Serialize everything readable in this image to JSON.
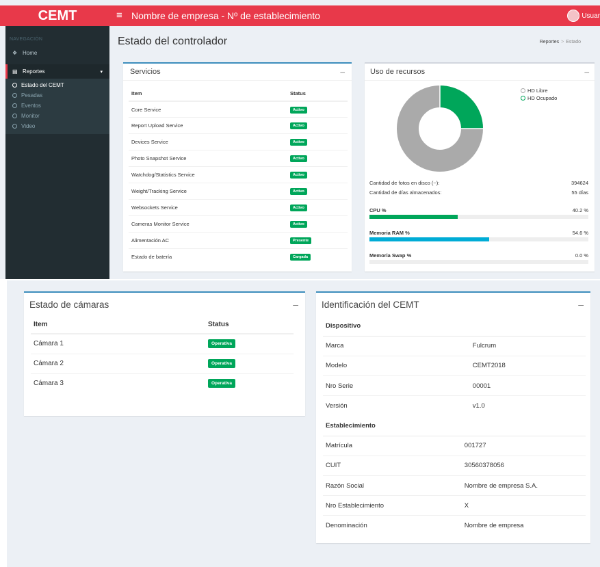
{
  "app": {
    "logo": "CEMT",
    "title": "Nombre de empresa - Nº de establecimiento",
    "user_label": "Usuar"
  },
  "sidebar": {
    "header": "NAVEGACIÓN",
    "items": [
      {
        "label": "Home",
        "icon": "home-icon"
      },
      {
        "label": "Reportes",
        "icon": "bar-chart-icon"
      }
    ],
    "subitems": [
      {
        "label": "Estado del CEMT"
      },
      {
        "label": "Pesadas"
      },
      {
        "label": "Eventos"
      },
      {
        "label": "Monitor"
      },
      {
        "label": "Video"
      }
    ]
  },
  "page": {
    "title": "Estado del controlador",
    "breadcrumb": [
      "Reportes",
      "Estado"
    ]
  },
  "services": {
    "title": "Servicios",
    "collapse_symbol": "–",
    "headers": [
      "Item",
      "Status"
    ],
    "rows": [
      {
        "item": "Core Service",
        "status": "Activo"
      },
      {
        "item": "Report Upload Service",
        "status": "Activo"
      },
      {
        "item": "Devices Service",
        "status": "Activo"
      },
      {
        "item": "Photo Snapshot Service",
        "status": "Activo"
      },
      {
        "item": "Watchdog/Statistics Service",
        "status": "Activo"
      },
      {
        "item": "Weight/Tracking Service",
        "status": "Activo"
      },
      {
        "item": "Websockets Service",
        "status": "Activo"
      },
      {
        "item": "Cameras Monitor Service",
        "status": "Activo"
      },
      {
        "item": "Alimentación AC",
        "status": "Presente"
      },
      {
        "item": "Estado de batería",
        "status": "Cargada"
      }
    ]
  },
  "resources": {
    "title": "Uso de recursos",
    "collapse_symbol": "–",
    "legend": [
      {
        "label": "HD Libre",
        "color": "#aaaaaa"
      },
      {
        "label": "HD Ocupado",
        "color": "#00a65a"
      }
    ],
    "disk_used_fraction": 0.25,
    "photos_label": "Cantidad de fotos en disco (~):",
    "photos_value": "394624",
    "days_label": "Cantidad de días almacenados:",
    "days_value": "55 días",
    "meters": [
      {
        "label": "CPU %",
        "value_text": "40.2 %",
        "percent": 40.2,
        "color": "#00a65a"
      },
      {
        "label": "Memoria RAM %",
        "value_text": "54.6 %",
        "percent": 54.6,
        "color": "#00acd6"
      },
      {
        "label": "Memoria Swap %",
        "value_text": "0.0 %",
        "percent": 0.0,
        "color": "#00a65a"
      }
    ]
  },
  "cameras": {
    "title": "Estado de cámaras",
    "collapse_symbol": "–",
    "headers": [
      "Item",
      "Status"
    ],
    "rows": [
      {
        "item": "Cámara 1",
        "status": "Operativa"
      },
      {
        "item": "Cámara 2",
        "status": "Operativa"
      },
      {
        "item": "Cámara 3",
        "status": "Operativa"
      }
    ]
  },
  "identification": {
    "title": "Identificación del CEMT",
    "collapse_symbol": "–",
    "device_section": "Dispositivo",
    "device_rows": [
      {
        "label": "Marca",
        "value": "Fulcrum"
      },
      {
        "label": "Modelo",
        "value": "CEMT2018"
      },
      {
        "label": "Nro Serie",
        "value": "00001"
      },
      {
        "label": "Versión",
        "value": "v1.0"
      }
    ],
    "establishment_section": "Establecimiento",
    "establishment_rows": [
      {
        "label": "Matrícula",
        "value": "001727"
      },
      {
        "label": "CUIT",
        "value": "30560378056"
      },
      {
        "label": "Razón Social",
        "value": "Nombre de empresa S.A."
      },
      {
        "label": "Nro Establecimiento",
        "value": "X"
      },
      {
        "label": "Denominación",
        "value": "Nombre de empresa"
      }
    ]
  }
}
